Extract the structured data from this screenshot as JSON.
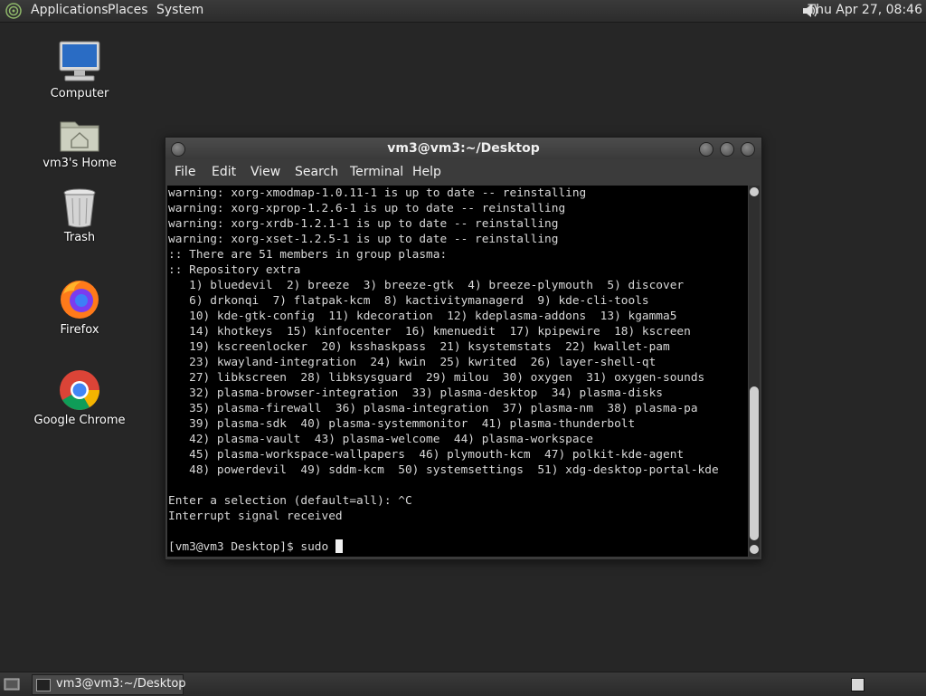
{
  "top_panel": {
    "menus": [
      "Applications",
      "Places",
      "System"
    ],
    "clock": "Thu Apr 27, 08:46",
    "icons": [
      "distro-logo-icon",
      "volume-icon"
    ]
  },
  "desktop": {
    "icons": [
      {
        "label": "Computer",
        "icon": "computer-icon"
      },
      {
        "label": "vm3's Home",
        "icon": "home-folder-icon"
      },
      {
        "label": "Trash",
        "icon": "trash-icon"
      },
      {
        "label": "Firefox",
        "icon": "firefox-icon"
      },
      {
        "label": "Google Chrome",
        "icon": "chrome-icon"
      }
    ]
  },
  "terminal_window": {
    "title": "vm3@vm3:~/Desktop",
    "menu": [
      "File",
      "Edit",
      "View",
      "Search",
      "Terminal",
      "Help"
    ],
    "lines": [
      "warning: xorg-xmodmap-1.0.11-1 is up to date -- reinstalling",
      "warning: xorg-xprop-1.2.6-1 is up to date -- reinstalling",
      "warning: xorg-xrdb-1.2.1-1 is up to date -- reinstalling",
      "warning: xorg-xset-1.2.5-1 is up to date -- reinstalling",
      ":: There are 51 members in group plasma:",
      ":: Repository extra",
      "   1) bluedevil  2) breeze  3) breeze-gtk  4) breeze-plymouth  5) discover",
      "   6) drkonqi  7) flatpak-kcm  8) kactivitymanagerd  9) kde-cli-tools",
      "   10) kde-gtk-config  11) kdecoration  12) kdeplasma-addons  13) kgamma5",
      "   14) khotkeys  15) kinfocenter  16) kmenuedit  17) kpipewire  18) kscreen",
      "   19) kscreenlocker  20) ksshaskpass  21) ksystemstats  22) kwallet-pam",
      "   23) kwayland-integration  24) kwin  25) kwrited  26) layer-shell-qt",
      "   27) libkscreen  28) libksysguard  29) milou  30) oxygen  31) oxygen-sounds",
      "   32) plasma-browser-integration  33) plasma-desktop  34) plasma-disks",
      "   35) plasma-firewall  36) plasma-integration  37) plasma-nm  38) plasma-pa",
      "   39) plasma-sdk  40) plasma-systemmonitor  41) plasma-thunderbolt",
      "   42) plasma-vault  43) plasma-welcome  44) plasma-workspace",
      "   45) plasma-workspace-wallpapers  46) plymouth-kcm  47) polkit-kde-agent",
      "   48) powerdevil  49) sddm-kcm  50) systemsettings  51) xdg-desktop-portal-kde",
      "",
      "Enter a selection (default=all): ^C",
      "Interrupt signal received",
      ""
    ],
    "prompt": "[vm3@vm3 Desktop]$ sudo "
  },
  "taskbar": {
    "tasks": [
      {
        "label": "vm3@vm3:~/Desktop"
      }
    ]
  }
}
